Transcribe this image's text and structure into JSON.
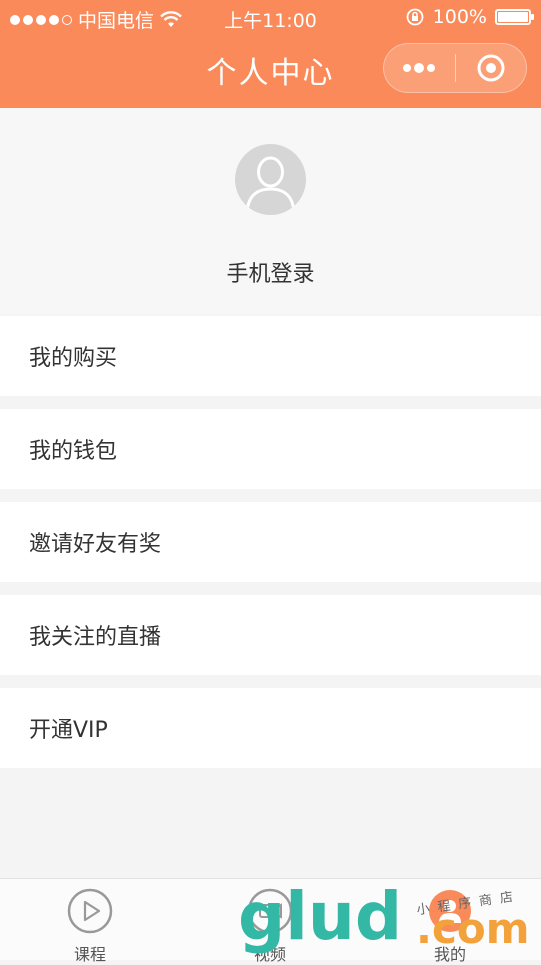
{
  "status_bar": {
    "carrier": "中国电信",
    "time": "上午11:00",
    "battery": "100%",
    "battery_level": 1.0,
    "signal_bars": 4,
    "signal_total": 5
  },
  "nav": {
    "title": "个人中心"
  },
  "profile": {
    "login_label": "手机登录"
  },
  "menu": [
    {
      "label": "我的购买"
    },
    {
      "label": "我的钱包"
    },
    {
      "label": "邀请好友有奖"
    },
    {
      "label": "我关注的直播"
    },
    {
      "label": "开通VIP"
    }
  ],
  "tabs": [
    {
      "label": "课程",
      "icon": "play-circle-icon"
    },
    {
      "label": "视频",
      "icon": "video-camera-icon"
    },
    {
      "label": "我的",
      "icon": "user-icon"
    }
  ],
  "watermark": {
    "main": "glud",
    "suffix": ".com",
    "tagline": "小程序商店"
  },
  "colors": {
    "header": "#fa8a5a",
    "background": "#f4f4f4",
    "text": "#333333",
    "tab_icon": "#999999"
  }
}
